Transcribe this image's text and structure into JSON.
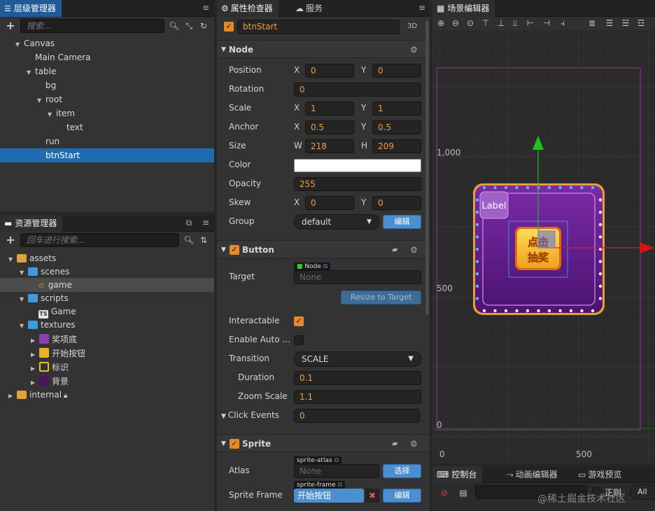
{
  "hierarchy": {
    "tab": "层级管理器",
    "search_placeholder": "搜索...",
    "nodes": [
      {
        "label": "Canvas"
      },
      {
        "label": "Main Camera"
      },
      {
        "label": "table"
      },
      {
        "label": "bg"
      },
      {
        "label": "root"
      },
      {
        "label": "item"
      },
      {
        "label": "text"
      },
      {
        "label": "run"
      },
      {
        "label": "btnStart"
      }
    ]
  },
  "assets": {
    "tab": "资源管理器",
    "search_placeholder": "回车进行搜索...",
    "items": [
      {
        "label": "assets"
      },
      {
        "label": "scenes"
      },
      {
        "label": "game"
      },
      {
        "label": "scripts"
      },
      {
        "label": "Game"
      },
      {
        "label": "textures"
      },
      {
        "label": "奖项底"
      },
      {
        "label": "开始按钮"
      },
      {
        "label": "标识"
      },
      {
        "label": "背景"
      },
      {
        "label": "internal"
      }
    ]
  },
  "inspector": {
    "tabs": [
      "属性检查器",
      "服务"
    ],
    "node_name": "btnStart",
    "mode_3d": "3D",
    "node_section": "Node",
    "position": {
      "label": "Position",
      "x": "0",
      "y": "0"
    },
    "rotation": {
      "label": "Rotation",
      "value": "0"
    },
    "scale": {
      "label": "Scale",
      "x": "1",
      "y": "1"
    },
    "anchor": {
      "label": "Anchor",
      "x": "0.5",
      "y": "0.5"
    },
    "size": {
      "label": "Size",
      "w": "218",
      "h": "209"
    },
    "color": {
      "label": "Color",
      "value": "#ffffff"
    },
    "opacity": {
      "label": "Opacity",
      "value": "255"
    },
    "skew": {
      "label": "Skew",
      "x": "0",
      "y": "0"
    },
    "group": {
      "label": "Group",
      "value": "default",
      "edit": "编辑"
    },
    "axis_labels": {
      "x": "X",
      "y": "Y",
      "w": "W",
      "h": "H"
    },
    "button_section": "Button",
    "target": {
      "label": "Target",
      "tag": "Node",
      "value": "None",
      "resize": "Resize to Target"
    },
    "interactable": {
      "label": "Interactable"
    },
    "enable_auto": {
      "label": "Enable Auto ..."
    },
    "transition": {
      "label": "Transition",
      "value": "SCALE"
    },
    "duration": {
      "label": "Duration",
      "value": "0.1"
    },
    "zoom_scale": {
      "label": "Zoom Scale",
      "value": "1.1"
    },
    "click_events": {
      "label": "Click Events",
      "value": "0"
    },
    "sprite_section": "Sprite",
    "atlas": {
      "label": "Atlas",
      "tag": "sprite-atlas",
      "value": "None",
      "button": "选择"
    },
    "sprite_frame": {
      "label": "Sprite Frame",
      "tag": "sprite-frame",
      "value": "开始按钮",
      "button": "编辑"
    }
  },
  "scene": {
    "tab": "场景编辑器",
    "ruler_y": [
      "1,000",
      "500",
      "0"
    ],
    "ruler_x": [
      "0",
      "500"
    ],
    "label_text": "Label",
    "button_text_top": "点击",
    "button_text_bottom": "抽奖"
  },
  "console": {
    "tabs": [
      "控制台",
      "动画编辑器",
      "游戏预览"
    ],
    "regex": "正则",
    "filter": "All",
    "watermark": "@稀土掘金技术社区"
  },
  "colors": {
    "accent": "#e38b2b",
    "selection": "#1e6bb0",
    "value": "#e8a044"
  }
}
